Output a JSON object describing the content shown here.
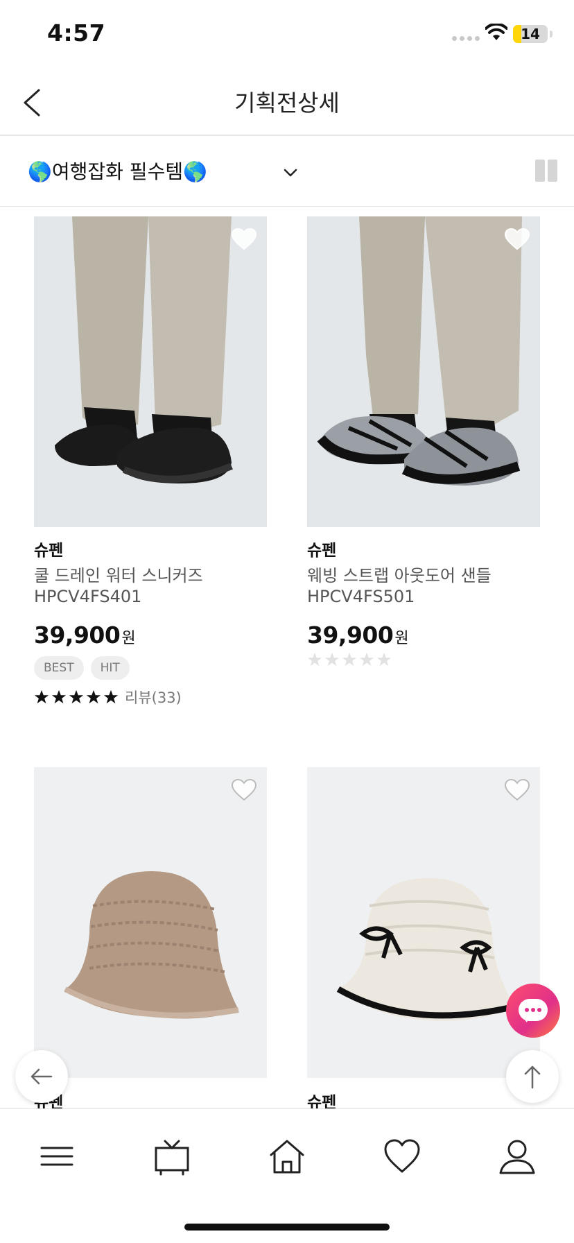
{
  "status_bar": {
    "time": "4:57",
    "battery": "14",
    "battery_color": "#ffd60a"
  },
  "header": {
    "title": "기획전상세",
    "back_icon": "chevron-left-icon"
  },
  "category": {
    "selected": "🌎여행잡화 필수템🌎",
    "dropdown_icon": "chevron-down-icon",
    "view_icon": "grid-view-icon"
  },
  "products": [
    {
      "brand": "슈펜",
      "name": "쿨 드레인 워터 스니커즈",
      "code": "HPCV4FS401",
      "price": "39,900",
      "currency": "원",
      "badges": [
        "BEST",
        "HIT"
      ],
      "rating": 5,
      "review": "리뷰(33)"
    },
    {
      "brand": "슈펜",
      "name": "웨빙 스트랩 아웃도어 샌들",
      "code": "HPCV4FS501",
      "price": "39,900",
      "currency": "원",
      "badges": [],
      "rating": 0,
      "review": ""
    },
    {
      "brand": "슈펜"
    },
    {
      "brand": "슈펜"
    }
  ],
  "floating": {
    "chat_icon": "chat-bubble-icon",
    "back_icon": "arrow-left-icon",
    "top_icon": "arrow-up-icon"
  },
  "bottom_nav": {
    "items": [
      "menu-icon",
      "tv-icon",
      "home-icon",
      "heart-icon",
      "user-icon"
    ]
  }
}
